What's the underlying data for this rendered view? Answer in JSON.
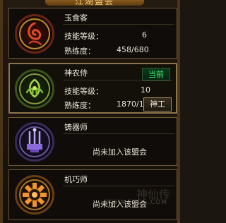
{
  "window": {
    "title": "江湖盟会"
  },
  "professions": [
    {
      "name": "玉食客",
      "skill_level_label": "技能等级：",
      "skill_level": "6",
      "proficiency_label": "熟练度：",
      "proficiency": "458/680",
      "emblem_icon": "red-swirl-emblem-icon",
      "accent": "#c83a2a"
    },
    {
      "name": "神农侍",
      "status_badge": "当前",
      "skill_level_label": "技能等级：",
      "skill_level": "10",
      "proficiency_label": "熟练度：",
      "proficiency": "1870/1870",
      "button_label": "神工",
      "emblem_icon": "green-leaf-emblem-icon",
      "accent": "#7ab83a"
    },
    {
      "name": "铸器师",
      "status_text": "尚未加入该盟会",
      "emblem_icon": "purple-anvil-emblem-icon",
      "accent": "#8a5ad0"
    },
    {
      "name": "机巧师",
      "status_text": "尚未加入该盟会",
      "emblem_icon": "orange-gear-emblem-icon",
      "accent": "#e0822a"
    }
  ],
  "watermark": {
    "text": "WWW.SXDS.COM",
    "logo": "神仙传"
  }
}
